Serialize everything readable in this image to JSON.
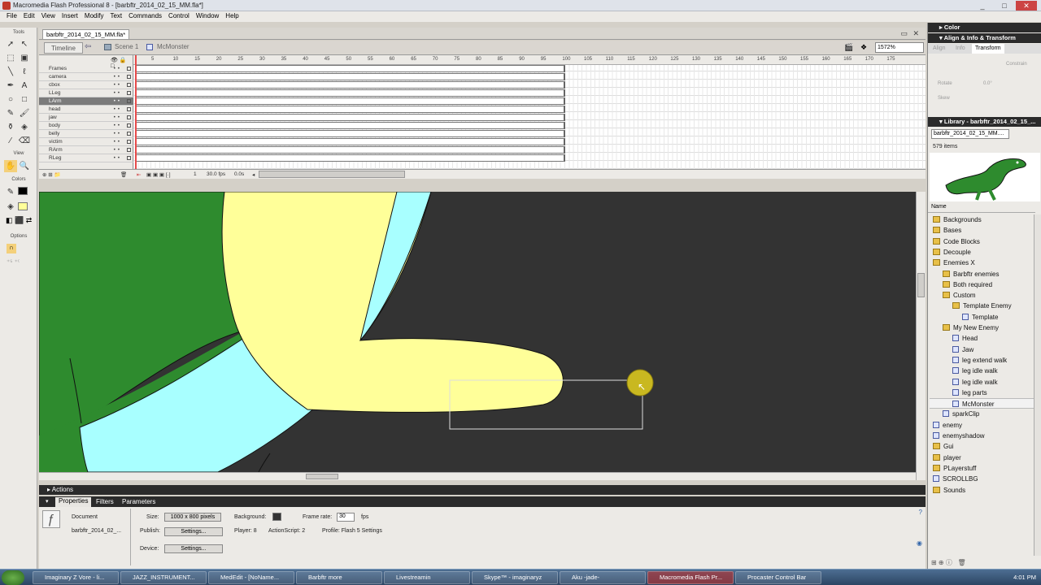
{
  "window": {
    "title": "Macromedia Flash Professional 8 - [barbftr_2014_02_15_MM.fla*]",
    "controls": [
      "_",
      "□",
      "✕"
    ]
  },
  "menu": [
    "File",
    "Edit",
    "View",
    "Insert",
    "Modify",
    "Text",
    "Commands",
    "Control",
    "Window",
    "Help"
  ],
  "tools": {
    "header": "Tools",
    "view": "View",
    "colors": "Colors",
    "options": "Options"
  },
  "document": {
    "tab": "barbftr_2014_02_15_MM.fla*"
  },
  "timeline": {
    "button": "Timeline",
    "scene": "Scene 1",
    "symbol": "McMonster",
    "zoom": "1572%",
    "layers": [
      "Frames",
      "camera",
      "cbox",
      "LLeg",
      "LArm",
      "head",
      "jaw",
      "body",
      "belly",
      "victim",
      "RArm",
      "RLeg"
    ],
    "selected_layer": "LArm",
    "ruler": [
      "5",
      "10",
      "15",
      "20",
      "25",
      "30",
      "35",
      "40",
      "45",
      "50",
      "55",
      "60",
      "65",
      "70",
      "75",
      "80",
      "85",
      "90",
      "95",
      "100",
      "105",
      "110",
      "115",
      "120",
      "125",
      "130",
      "135",
      "140",
      "145",
      "150",
      "155",
      "160",
      "165",
      "170",
      "175"
    ],
    "current_frame": "1",
    "fps": "30.0 fps",
    "time": "0.0s"
  },
  "actions": {
    "label": "Actions"
  },
  "properties": {
    "tabs": [
      "Properties",
      "Filters",
      "Parameters"
    ],
    "type": "Document",
    "name": "barbftr_2014_02_...",
    "size_label": "Size:",
    "size_value": "1000 x 800 pixels",
    "publish_label": "Publish:",
    "settings": "Settings...",
    "device_label": "Device:",
    "background_label": "Background:",
    "framerate_label": "Frame rate:",
    "framerate": "30",
    "fps": "fps",
    "player": "Player: 8",
    "actionscript": "ActionScript: 2",
    "profile": "Profile: Flash 5 Settings"
  },
  "panels": {
    "color": "Color",
    "align": "Align & Info & Transform",
    "tabs": [
      "Align",
      "Info",
      "Transform"
    ],
    "constrain": "Constrain",
    "rotate": "Rotate",
    "rotate_val": "0.0°",
    "skew": "Skew",
    "library": "Library - barbftr_2014_02_15_...",
    "library_select": "barbftr_2014_02_15_MM....",
    "count": "579 items",
    "name_col": "Name",
    "items": [
      {
        "label": "Backgrounds",
        "type": "folder",
        "indent": 0
      },
      {
        "label": "Bases",
        "type": "folder",
        "indent": 0
      },
      {
        "label": "Code Blocks",
        "type": "folder",
        "indent": 0
      },
      {
        "label": "Decouple",
        "type": "folder",
        "indent": 0
      },
      {
        "label": "Enemies X",
        "type": "folder",
        "indent": 0
      },
      {
        "label": "Barbftr enemies",
        "type": "folder",
        "indent": 1
      },
      {
        "label": "Both required",
        "type": "folder",
        "indent": 1
      },
      {
        "label": "Custom",
        "type": "folder",
        "indent": 1
      },
      {
        "label": "Template Enemy",
        "type": "folder",
        "indent": 2
      },
      {
        "label": "Template",
        "type": "symbol",
        "indent": 3
      },
      {
        "label": "My New Enemy",
        "type": "folder",
        "indent": 1
      },
      {
        "label": "Head",
        "type": "symbol",
        "indent": 2
      },
      {
        "label": "Jaw",
        "type": "symbol",
        "indent": 2
      },
      {
        "label": "leg extend walk",
        "type": "symbol",
        "indent": 2
      },
      {
        "label": "leg idle walk",
        "type": "symbol",
        "indent": 2
      },
      {
        "label": "leg idle walk",
        "type": "symbol",
        "indent": 2
      },
      {
        "label": "leg parts",
        "type": "symbol",
        "indent": 2
      },
      {
        "label": "McMonster",
        "type": "symbol",
        "indent": 2
      },
      {
        "label": "sparkClip",
        "type": "symbol",
        "indent": 1
      },
      {
        "label": "enemy",
        "type": "symbol",
        "indent": 0
      },
      {
        "label": "enemyshadow",
        "type": "symbol",
        "indent": 0
      },
      {
        "label": "Gui",
        "type": "folder",
        "indent": 0
      },
      {
        "label": "player",
        "type": "folder",
        "indent": 0
      },
      {
        "label": "PLayerstuff",
        "type": "folder",
        "indent": 0
      },
      {
        "label": "SCROLLBG",
        "type": "symbol",
        "indent": 0
      },
      {
        "label": "Sounds",
        "type": "folder",
        "indent": 0
      }
    ],
    "selected_item": "McMonster"
  },
  "taskbar": {
    "items": [
      "Imaginary Z Vore - li...",
      "JAZZ_INSTRUMENT...",
      "MedEdit - [NoName...",
      "Barbftr more",
      "Livestreamin",
      "Skype™ - imaginaryz",
      "Aku -jade-",
      "Macromedia Flash Pr...",
      "Procaster Control Bar"
    ],
    "active": "Macromedia Flash Pr...",
    "clock": "4:01 PM"
  },
  "colors": {
    "stage": "#333333",
    "green": "#2e8b2e",
    "cyan": "#a8ffff",
    "yellow": "#ffff99",
    "accent": "#e64b4b"
  }
}
